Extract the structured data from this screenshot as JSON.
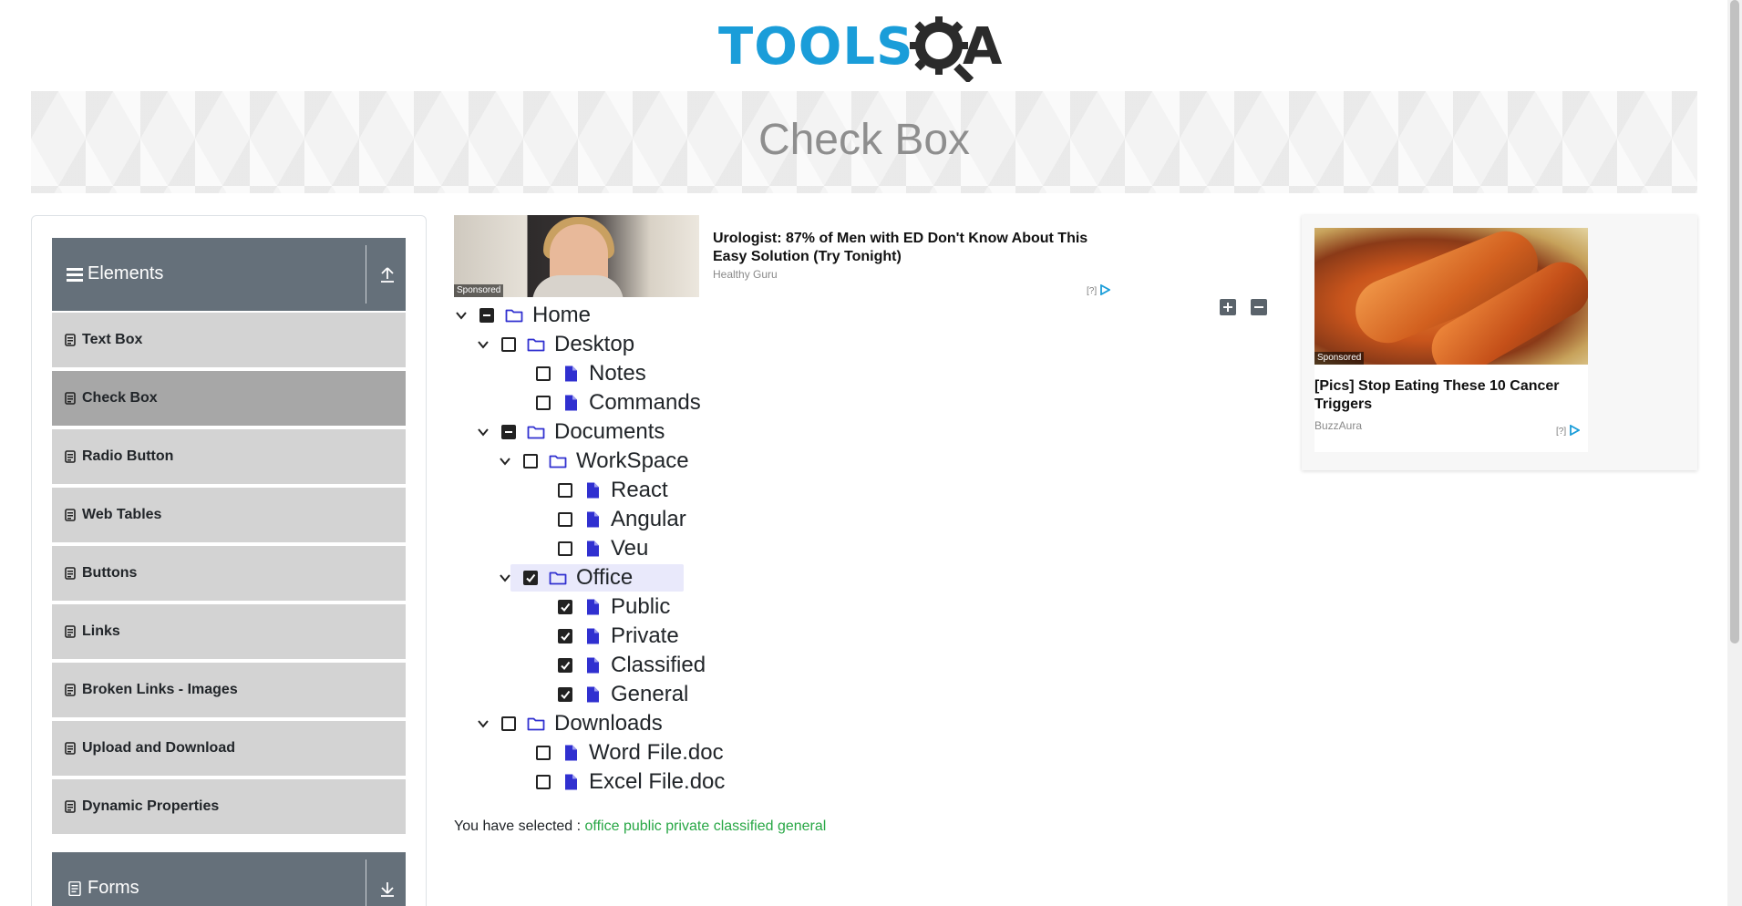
{
  "header": {
    "logo_main": "TOOLS",
    "logo_q": "Q",
    "logo_a": "A"
  },
  "banner": {
    "title": "Check Box"
  },
  "sidebar": {
    "groups": [
      {
        "label": "Elements",
        "expanded": true,
        "items": [
          {
            "label": "Text Box",
            "active": false
          },
          {
            "label": "Check Box",
            "active": true
          },
          {
            "label": "Radio Button",
            "active": false
          },
          {
            "label": "Web Tables",
            "active": false
          },
          {
            "label": "Buttons",
            "active": false
          },
          {
            "label": "Links",
            "active": false
          },
          {
            "label": "Broken Links - Images",
            "active": false
          },
          {
            "label": "Upload and Download",
            "active": false
          },
          {
            "label": "Dynamic Properties",
            "active": false
          }
        ]
      },
      {
        "label": "Forms",
        "expanded": false,
        "items": []
      }
    ]
  },
  "tree": {
    "nodes": [
      {
        "label": "Home",
        "level": 0,
        "type": "folder",
        "state": "half",
        "expandable": true
      },
      {
        "label": "Desktop",
        "level": 1,
        "type": "folder",
        "state": "unchecked",
        "expandable": true
      },
      {
        "label": "Notes",
        "level": 2,
        "type": "file",
        "state": "unchecked",
        "expandable": false
      },
      {
        "label": "Commands",
        "level": 2,
        "type": "file",
        "state": "unchecked",
        "expandable": false
      },
      {
        "label": "Documents",
        "level": 1,
        "type": "folder",
        "state": "half",
        "expandable": true
      },
      {
        "label": "WorkSpace",
        "level": 2,
        "type": "folder",
        "state": "unchecked",
        "expandable": true
      },
      {
        "label": "React",
        "level": 3,
        "type": "file",
        "state": "unchecked",
        "expandable": false
      },
      {
        "label": "Angular",
        "level": 3,
        "type": "file",
        "state": "unchecked",
        "expandable": false
      },
      {
        "label": "Veu",
        "level": 3,
        "type": "file",
        "state": "unchecked",
        "expandable": false
      },
      {
        "label": "Office",
        "level": 2,
        "type": "folder",
        "state": "checked",
        "expandable": true,
        "highlight": true
      },
      {
        "label": "Public",
        "level": 3,
        "type": "file",
        "state": "checked",
        "expandable": false
      },
      {
        "label": "Private",
        "level": 3,
        "type": "file",
        "state": "checked",
        "expandable": false
      },
      {
        "label": "Classified",
        "level": 3,
        "type": "file",
        "state": "checked",
        "expandable": false
      },
      {
        "label": "General",
        "level": 3,
        "type": "file",
        "state": "checked",
        "expandable": false
      },
      {
        "label": "Downloads",
        "level": 1,
        "type": "folder",
        "state": "unchecked",
        "expandable": true
      },
      {
        "label": "Word File.doc",
        "level": 2,
        "type": "file",
        "state": "unchecked",
        "expandable": false
      },
      {
        "label": "Excel File.doc",
        "level": 2,
        "type": "file",
        "state": "unchecked",
        "expandable": false
      }
    ],
    "expand_all_icon": "plus-square-icon",
    "collapse_all_icon": "minus-square-icon"
  },
  "result": {
    "prefix": "You have selected :",
    "selected": [
      "office",
      "public",
      "private",
      "classified",
      "general"
    ]
  },
  "ads": {
    "ad1": {
      "sponsored": "Sponsored",
      "title": "Urologist: 87% of Men with ED Don't Know About This Easy Solution (Try Tonight)",
      "source": "Healthy Guru",
      "adchoice": "[?]"
    },
    "ad2": {
      "sponsored": "Sponsored",
      "title": "[Pics] Stop Eating These 10 Cancer Triggers",
      "source": "BuzzAura",
      "adchoice": "[?]"
    }
  },
  "colors": {
    "accent_blue": "#1a9dd9",
    "sidebar_header": "#65707a",
    "menu_item": "#d3d3d3",
    "menu_item_active": "#a7a7a7",
    "tree_icon": "#3030d0",
    "selected_text": "#28a745"
  }
}
